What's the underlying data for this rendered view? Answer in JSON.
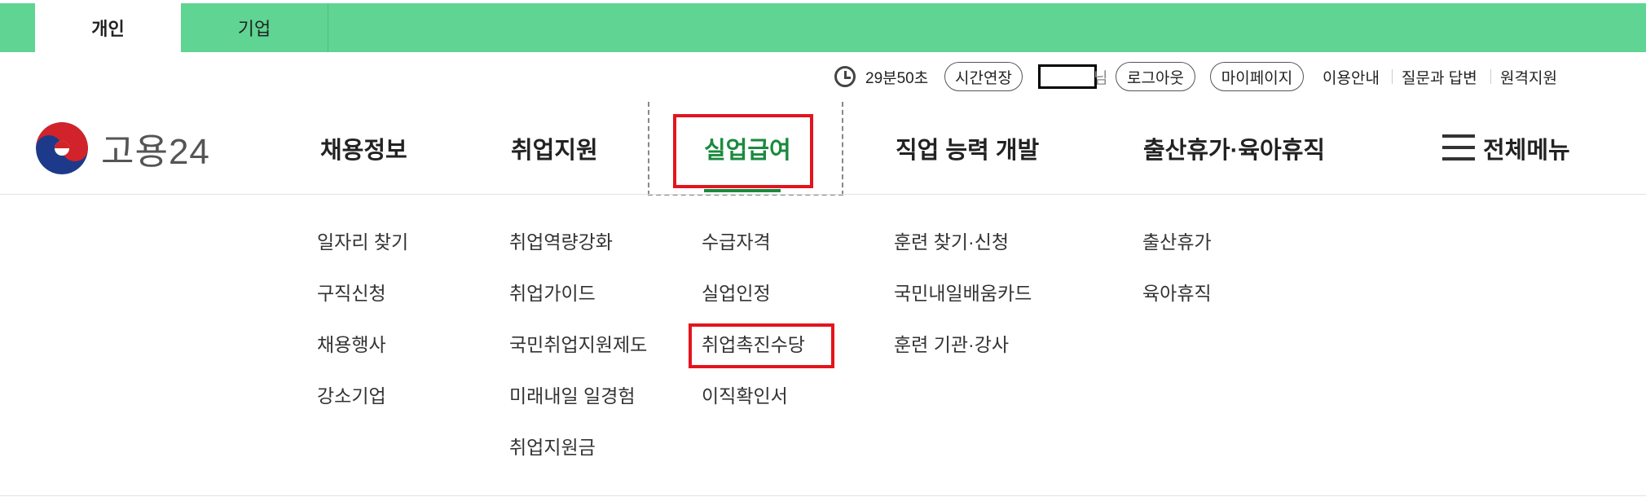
{
  "top_tabs": {
    "personal": "개인",
    "business": "기업"
  },
  "util": {
    "time_remaining": "29분50초",
    "extend_button": "시간연장",
    "user_suffix": "님",
    "logout_button": "로그아웃",
    "mypage_button": "마이페이지",
    "links": [
      "이용안내",
      "질문과 답변",
      "원격지원"
    ]
  },
  "logo": {
    "text": "고용24"
  },
  "nav": {
    "items": [
      "채용정보",
      "취업지원",
      "실업급여",
      "직업 능력 개발",
      "출산휴가·육아휴직"
    ],
    "all_menu": "전체메뉴"
  },
  "submenu": {
    "col1": [
      "일자리 찾기",
      "구직신청",
      "채용행사",
      "강소기업"
    ],
    "col2": [
      "취업역량강화",
      "취업가이드",
      "국민취업지원제도",
      "미래내일 일경험",
      "취업지원금"
    ],
    "col3": [
      "수급자격",
      "실업인정",
      "취업촉진수당",
      "이직확인서"
    ],
    "col4": [
      "훈련 찾기·신청",
      "국민내일배움카드",
      "훈련 기관·강사"
    ],
    "col5": [
      "출산휴가",
      "육아휴직"
    ]
  },
  "colors": {
    "topbar": "#5fd493",
    "active_green": "#1a8a3e",
    "highlight_red": "#e3141d"
  }
}
